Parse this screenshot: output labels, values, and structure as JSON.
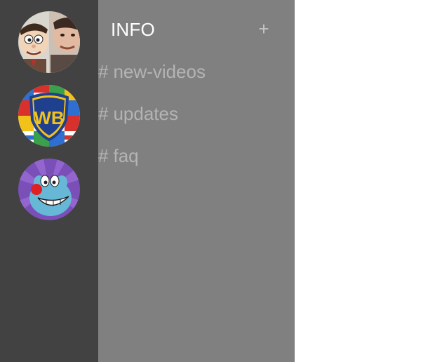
{
  "servers": [
    {
      "icon": "mr-bean-server-icon"
    },
    {
      "icon": "warner-bros-server-icon"
    },
    {
      "icon": "oggy-server-icon"
    }
  ],
  "panel": {
    "title": "INFO",
    "add_label": "+"
  },
  "channels": [
    {
      "hash": "#",
      "name": "new-videos"
    },
    {
      "hash": "#",
      "name": "updates"
    },
    {
      "hash": "#",
      "name": "faq"
    }
  ],
  "colors": {
    "server_rail_bg": "#424242",
    "channel_panel_bg": "#808080",
    "title_text": "#ffffff",
    "channel_text": "#b4b4b4",
    "add_button": "#c4c4c4",
    "canvas_bg": "#ffffff"
  }
}
